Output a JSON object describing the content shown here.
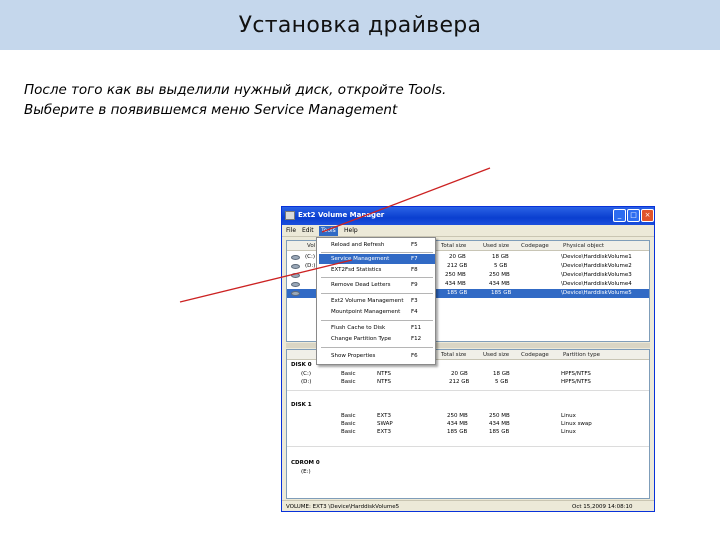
{
  "slide": {
    "title": "Установка драйвера",
    "instruction_line1": "После того как вы выделили нужный диск, откройте Tools.",
    "instruction_line2": "Выберите в появившемся меню Service Management"
  },
  "window": {
    "caption": "Ext2 Volume Manager",
    "btn_min": "_",
    "btn_max": "□",
    "btn_close": "×"
  },
  "menubar": {
    "file": "File",
    "edit": "Edit",
    "tools": "Tools",
    "help": "Help"
  },
  "volumes": {
    "headers": {
      "volume": "Vol",
      "total": "Total size",
      "used": "Used size",
      "codepage": "Codepage",
      "physical": "Physical object"
    },
    "rows": [
      {
        "name": "(C:)",
        "total": "20 GB",
        "used": "18 GB",
        "physical": "\\Device\\HarddiskVolume1"
      },
      {
        "name": "(D:)",
        "total": "212 GB",
        "used": "5 GB",
        "physical": "\\Device\\HarddiskVolume2"
      },
      {
        "name": "",
        "total": "250 MB",
        "used": "250 MB",
        "physical": "\\Device\\HarddiskVolume3"
      },
      {
        "name": "",
        "total": "434 MB",
        "used": "434 MB",
        "physical": "\\Device\\HarddiskVolume4"
      },
      {
        "name": "",
        "total": "185 GB",
        "used": "185 GB",
        "physical": "\\Device\\HarddiskVolume5"
      }
    ]
  },
  "tools_menu": {
    "items": [
      {
        "label": "Reload and Refresh",
        "shortcut": "F5"
      },
      {
        "label": "Service Management",
        "shortcut": "F7"
      },
      {
        "label": "EXT2Fsd Statistics",
        "shortcut": "F8"
      },
      {
        "label": "Remove Dead Letters",
        "shortcut": "F9"
      },
      {
        "label": "Ext2 Volume Management",
        "shortcut": "F3"
      },
      {
        "label": "Mountpoint Management",
        "shortcut": "F4"
      },
      {
        "label": "Flush Cache to Disk",
        "shortcut": "F11"
      },
      {
        "label": "Change Partition Type",
        "shortcut": "F12"
      },
      {
        "label": "Show Properties",
        "shortcut": "F6"
      }
    ]
  },
  "disks": {
    "headers": {
      "total": "Total size",
      "used": "Used size",
      "codepage": "Codepage",
      "partition": "Partition type"
    },
    "disk0": {
      "label": "DISK 0",
      "rows": [
        {
          "name": "(C:)",
          "type": "Basic",
          "fs": "NTFS",
          "total": "20 GB",
          "used": "18 GB",
          "partition": "HPFS/NTFS"
        },
        {
          "name": "(D:)",
          "type": "Basic",
          "fs": "NTFS",
          "total": "212 GB",
          "used": "5 GB",
          "partition": "HPFS/NTFS"
        }
      ]
    },
    "disk1": {
      "label": "DISK 1",
      "rows": [
        {
          "name": "",
          "type": "Basic",
          "fs": "EXT3",
          "total": "250 MB",
          "used": "250 MB",
          "partition": "Linux"
        },
        {
          "name": "",
          "type": "Basic",
          "fs": "SWAP",
          "total": "434 MB",
          "used": "434 MB",
          "partition": "Linux swap"
        },
        {
          "name": "",
          "type": "Basic",
          "fs": "EXT3",
          "total": "185 GB",
          "used": "185 GB",
          "partition": "Linux"
        }
      ]
    },
    "cdrom0": {
      "label": "CDROM 0",
      "row_name": "(E:)"
    }
  },
  "statusbar": {
    "left": "VOLUME:  EXT3 \\Device\\HarddiskVolume5",
    "right": "Oct 15,2009 14:08:10"
  },
  "colors": {
    "title_band": "#c5d7ec",
    "selection": "#316ac5",
    "arrow": "#cc2222"
  }
}
